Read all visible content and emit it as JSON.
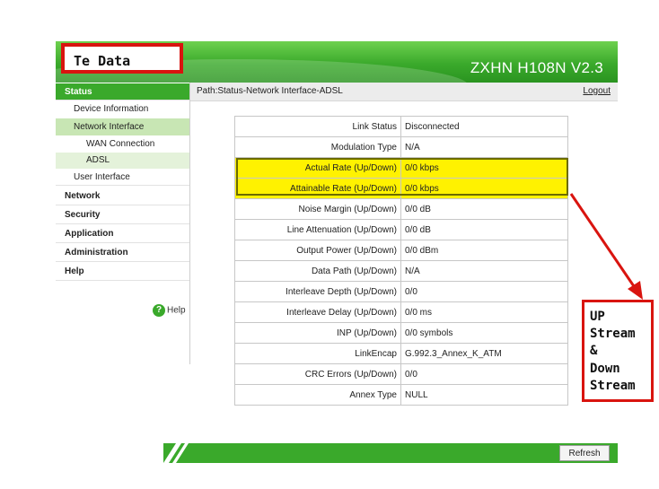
{
  "badge": {
    "text": "Te Data"
  },
  "header": {
    "product": "ZXHN H108N V2.3"
  },
  "sidebar": {
    "status": "Status",
    "device_information": "Device Information",
    "network_interface": "Network Interface",
    "wan_connection": "WAN Connection",
    "adsl": "ADSL",
    "user_interface": "User Interface",
    "network": "Network",
    "security": "Security",
    "application": "Application",
    "administration": "Administration",
    "help": "Help",
    "help_link": "Help"
  },
  "pathbar": {
    "path": "Path:Status-Network Interface-ADSL",
    "logout": "Logout"
  },
  "table": {
    "rows": [
      {
        "label": "Link Status",
        "value": "Disconnected"
      },
      {
        "label": "Modulation Type",
        "value": "N/A"
      },
      {
        "label": "Actual Rate (Up/Down)",
        "value": "0/0 kbps",
        "highlight": true
      },
      {
        "label": "Attainable Rate (Up/Down)",
        "value": "0/0 kbps",
        "highlight": true
      },
      {
        "label": "Noise Margin (Up/Down)",
        "value": "0/0 dB"
      },
      {
        "label": "Line Attenuation (Up/Down)",
        "value": "0/0 dB"
      },
      {
        "label": "Output Power (Up/Down)",
        "value": "0/0 dBm"
      },
      {
        "label": "Data Path (Up/Down)",
        "value": "N/A"
      },
      {
        "label": "Interleave Depth (Up/Down)",
        "value": "0/0"
      },
      {
        "label": "Interleave Delay (Up/Down)",
        "value": "0/0 ms"
      },
      {
        "label": "INP (Up/Down)",
        "value": "0/0 symbols"
      },
      {
        "label": "LinkEncap",
        "value": "G.992.3_Annex_K_ATM"
      },
      {
        "label": "CRC Errors (Up/Down)",
        "value": "0/0"
      },
      {
        "label": "Annex Type",
        "value": "NULL"
      }
    ]
  },
  "footer": {
    "refresh": "Refresh"
  },
  "annotation": {
    "lines": [
      "UP",
      "Stream",
      "&",
      "Down",
      "Stream"
    ]
  },
  "colors": {
    "brand_green": "#3aa92b",
    "highlight": "#fff200",
    "annotation_red": "#d9140f"
  }
}
